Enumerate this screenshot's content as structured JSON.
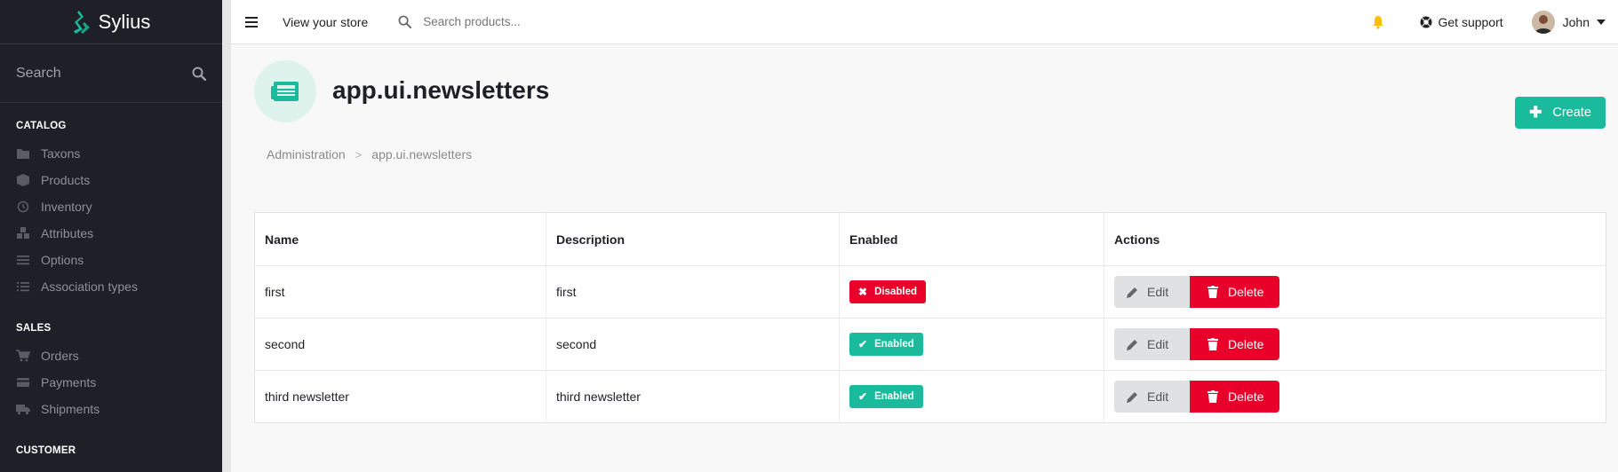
{
  "sidebar": {
    "logo_text": "Sylius",
    "search_label": "Search",
    "sections": [
      {
        "title": "CATALOG",
        "items": [
          {
            "label": "Taxons",
            "icon": "folder-icon"
          },
          {
            "label": "Products",
            "icon": "cube-icon"
          },
          {
            "label": "Inventory",
            "icon": "history-icon"
          },
          {
            "label": "Attributes",
            "icon": "cubes-icon"
          },
          {
            "label": "Options",
            "icon": "options-icon"
          },
          {
            "label": "Association types",
            "icon": "tasks-icon"
          }
        ]
      },
      {
        "title": "SALES",
        "items": [
          {
            "label": "Orders",
            "icon": "cart-icon"
          },
          {
            "label": "Payments",
            "icon": "credit-card-icon"
          },
          {
            "label": "Shipments",
            "icon": "truck-icon"
          }
        ]
      },
      {
        "title": "CUSTOMER",
        "items": []
      }
    ]
  },
  "topbar": {
    "view_store": "View your store",
    "search_placeholder": "Search products...",
    "support": "Get support",
    "user": "John"
  },
  "header": {
    "title": "app.ui.newsletters",
    "create_label": "Create",
    "breadcrumb": [
      "Administration",
      "app.ui.newsletters"
    ]
  },
  "table": {
    "columns": [
      "Name",
      "Description",
      "Enabled",
      "Actions"
    ],
    "rows": [
      {
        "name": "first",
        "description": "first",
        "status": "Disabled"
      },
      {
        "name": "second",
        "description": "second",
        "status": "Enabled"
      },
      {
        "name": "third newsletter",
        "description": "third newsletter",
        "status": "Enabled"
      }
    ],
    "edit_label": "Edit",
    "delete_label": "Delete"
  },
  "colors": {
    "sidebar_bg": "#1f2027",
    "accent": "#1abb9c",
    "danger": "#e8002a",
    "bell": "#fbbd08"
  }
}
